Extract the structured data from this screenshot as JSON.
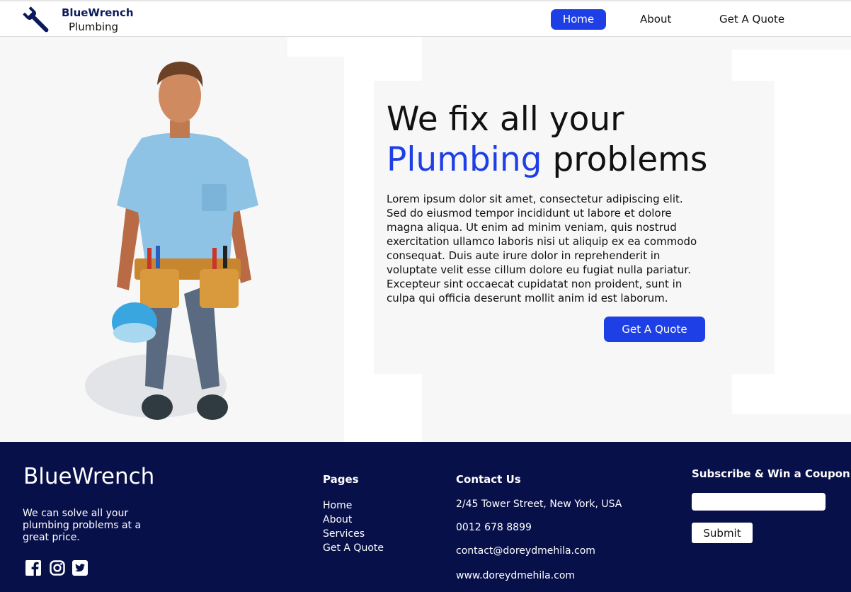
{
  "header": {
    "logo_title": "BlueWrench",
    "logo_subtitle": "Plumbing",
    "logo_icon": "wrench-icon",
    "nav": [
      {
        "label": "Home",
        "active": true
      },
      {
        "label": "About",
        "active": false
      },
      {
        "label": "Get A Quote",
        "active": false
      }
    ]
  },
  "hero": {
    "headline_line1": "We fix all your",
    "headline_accent": "Plumbing",
    "headline_rest": "problems",
    "body": "Lorem ipsum dolor sit amet, consectetur adipiscing elit. Sed do eiusmod tempor incididunt ut labore et dolore magna aliqua. Ut enim ad minim veniam, quis nostrud exercitation ullamco laboris nisi ut aliquip ex ea commodo consequat. Duis aute irure dolor in reprehenderit in voluptate velit esse cillum dolore eu fugiat nulla pariatur. Excepteur sint occaecat cupidatat non proident, sunt in culpa qui officia deserunt mollit anim id est laborum.",
    "cta_label": "Get A Quote",
    "image": "plumber-illustration"
  },
  "footer": {
    "brand": "BlueWrench",
    "tagline": "We can solve all your plumbing problems at a great price.",
    "social": [
      "facebook-icon",
      "instagram-icon",
      "twitter-icon"
    ],
    "pages_heading": "Pages",
    "pages": [
      "Home",
      "About",
      "Services",
      "Get A Quote"
    ],
    "contact_heading": "Contact Us",
    "contact": {
      "address": "2/45 Tower Street, New York, USA",
      "phone": "0012 678 8899",
      "email": "contact@doreydmehila.com",
      "website": "www.doreydmehila.com"
    },
    "subscribe_heading": "Subscribe & Win a Coupon",
    "subscribe_value": "",
    "submit_label": "Submit"
  },
  "colors": {
    "accent": "#1f3fe6",
    "footer_bg": "#08104a",
    "hero_bg": "#f7f7f7"
  }
}
